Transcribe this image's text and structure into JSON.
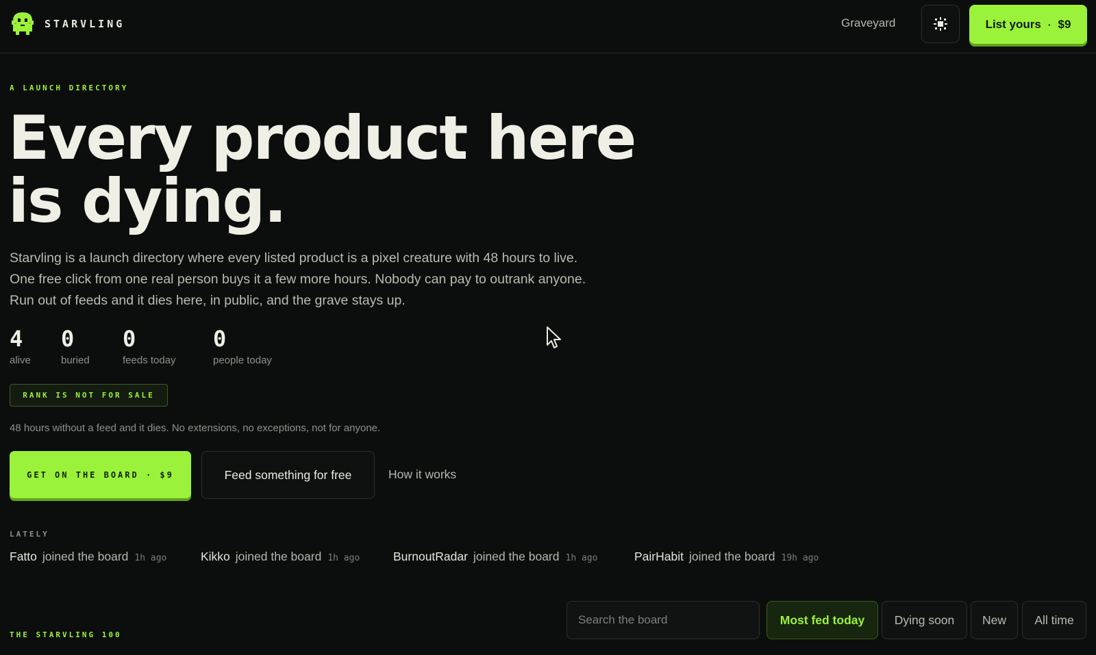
{
  "header": {
    "brand": "STARVLING",
    "nav_link": "Graveyard",
    "theme_toggle_icon": "sun-icon",
    "list_button": {
      "label": "List yours",
      "separator": "·",
      "price": "$9"
    }
  },
  "hero": {
    "eyebrow": "A LAUNCH DIRECTORY",
    "headline": "Every product here is dying.",
    "intro": "Starvling is a launch directory where every listed product is a pixel creature with 48 hours to live. One free click from one real person buys it a few more hours. Nobody can pay to outrank anyone. Run out of feeds and it dies here, in public, and the grave stays up."
  },
  "stats": [
    {
      "value": "4",
      "label": "alive"
    },
    {
      "value": "0",
      "label": "buried"
    },
    {
      "value": "0",
      "label": "feeds today"
    },
    {
      "value": "0",
      "label": "people today"
    }
  ],
  "badge": "RANK IS NOT FOR SALE",
  "rule_text": "48 hours without a feed and it dies. No extensions, no exceptions, not for anyone.",
  "cta": {
    "primary": "GET ON THE BOARD · $9",
    "secondary": "Feed something for free",
    "link": "How it works"
  },
  "lately": {
    "heading": "LATELY",
    "items": [
      {
        "name": "Fatto",
        "verb": "joined the board",
        "time": "1h ago"
      },
      {
        "name": "Kikko",
        "verb": "joined the board",
        "time": "1h ago"
      },
      {
        "name": "BurnoutRadar",
        "verb": "joined the board",
        "time": "1h ago"
      },
      {
        "name": "PairHabit",
        "verb": "joined the board",
        "time": "19h ago"
      }
    ]
  },
  "board": {
    "heading": "THE STARVLING 100",
    "search_placeholder": "Search the board",
    "tabs": [
      {
        "label": "Most fed today",
        "active": true
      },
      {
        "label": "Dying soon",
        "active": false
      },
      {
        "label": "New",
        "active": false
      },
      {
        "label": "All time",
        "active": false
      }
    ]
  },
  "colors": {
    "background": "#0c0e0d",
    "accent": "#9bf23a",
    "text": "#ecece4",
    "muted": "#8d918a"
  }
}
